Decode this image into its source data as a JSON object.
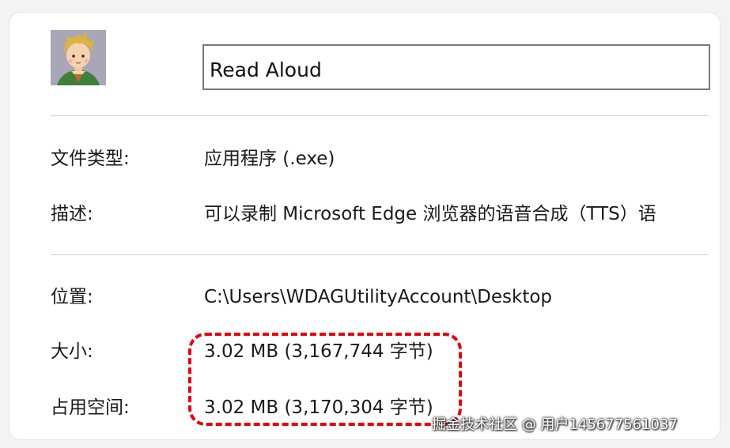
{
  "app": {
    "name_value": "Read Aloud",
    "icon": "cartoon-avatar-icon"
  },
  "properties": {
    "file_type_label": "文件类型:",
    "file_type_value": "应用程序 (.exe)",
    "description_label": "描述:",
    "description_value": "可以录制 Microsoft Edge 浏览器的语音合成（TTS）语",
    "location_label": "位置:",
    "location_value": "C:\\Users\\WDAGUtilityAccount\\Desktop",
    "size_label": "大小:",
    "size_value": "3.02 MB (3,167,744 字节)",
    "size_on_disk_label": "占用空间:",
    "size_on_disk_value": "3.02 MB (3,170,304 字节)"
  },
  "annotation": {
    "highlight_color": "#e8000b"
  },
  "watermark": {
    "text": "掘金技术社区 @ 用户145677561037"
  }
}
